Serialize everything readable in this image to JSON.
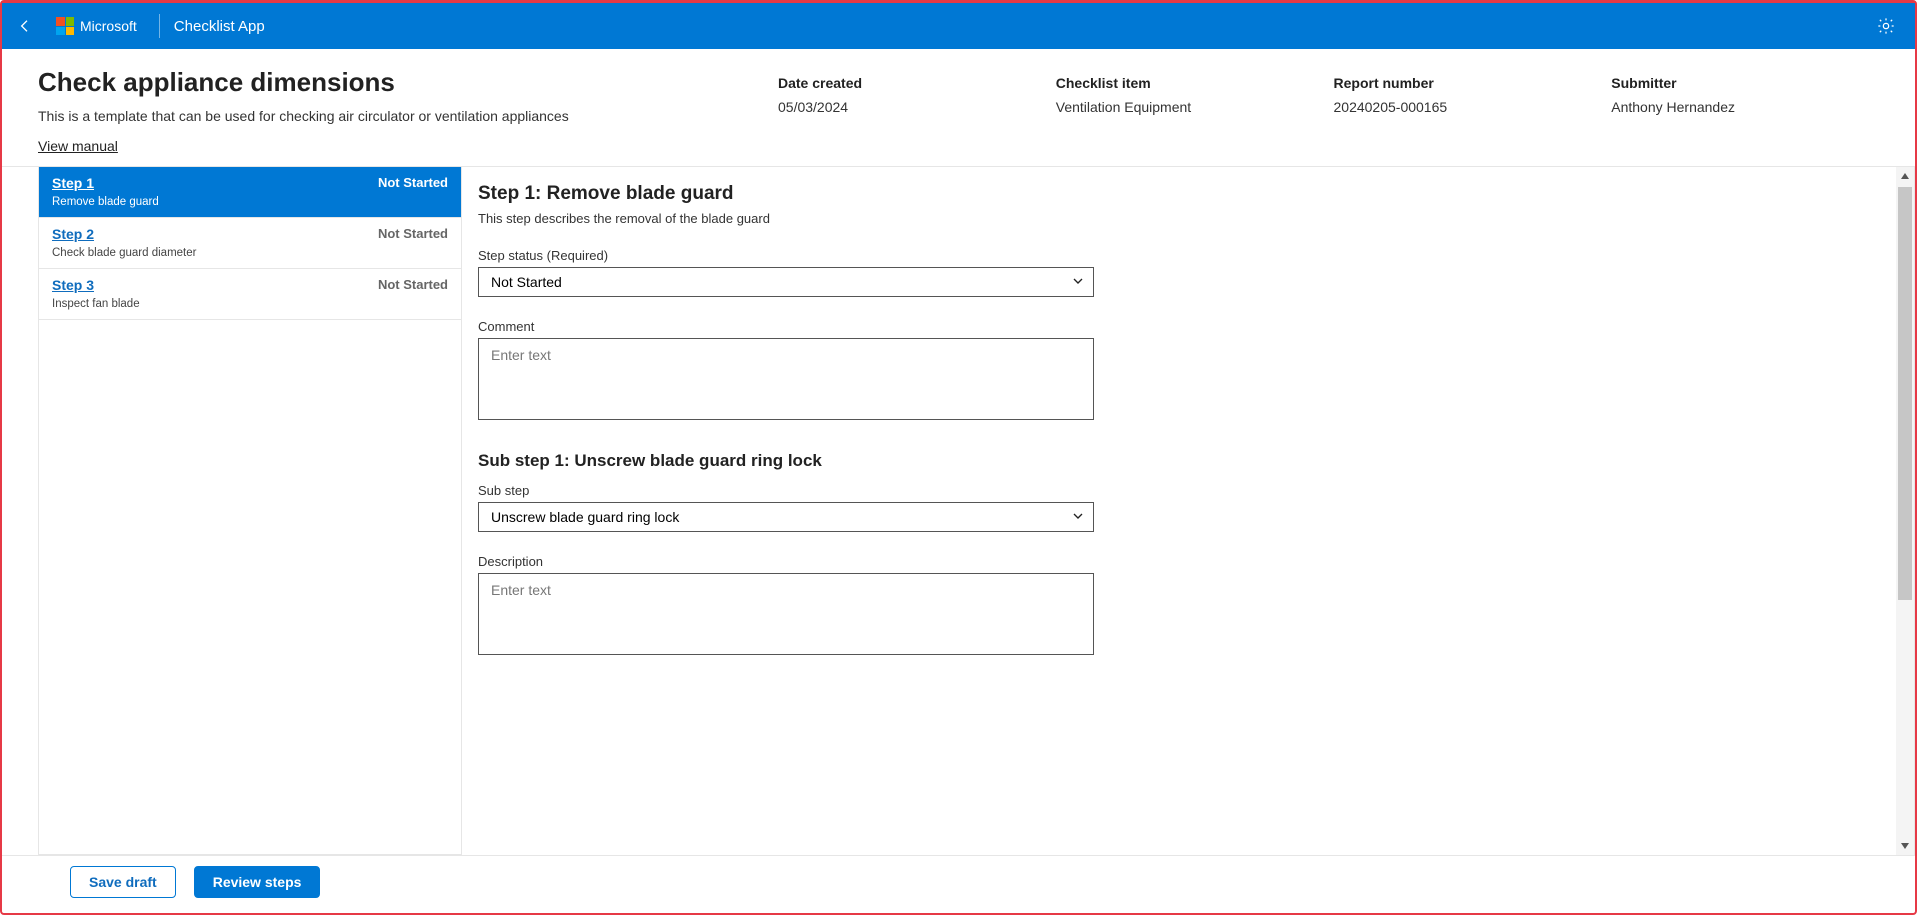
{
  "header": {
    "brand": "Microsoft",
    "app_name": "Checklist App"
  },
  "page": {
    "title": "Check appliance dimensions",
    "description": "This is a template that can be used for checking air circulator or ventilation appliances",
    "view_manual": "View manual"
  },
  "meta": {
    "date_created_label": "Date created",
    "date_created_value": "05/03/2024",
    "checklist_item_label": "Checklist item",
    "checklist_item_value": "Ventilation Equipment",
    "report_number_label": "Report number",
    "report_number_value": "20240205-000165",
    "submitter_label": "Submitter",
    "submitter_value": "Anthony Hernandez"
  },
  "steps": [
    {
      "label": "Step 1",
      "subtitle": "Remove blade guard",
      "status": "Not Started",
      "active": true
    },
    {
      "label": "Step 2",
      "subtitle": "Check blade guard diameter",
      "status": "Not Started",
      "active": false
    },
    {
      "label": "Step 3",
      "subtitle": "Inspect fan blade",
      "status": "Not Started",
      "active": false
    }
  ],
  "detail": {
    "title": "Step 1: Remove blade guard",
    "desc": "This step describes the removal of the blade guard",
    "status_label": "Step status (Required)",
    "status_value": "Not Started",
    "comment_label": "Comment",
    "comment_placeholder": "Enter text",
    "substep_title": "Sub step 1: Unscrew blade guard ring lock",
    "substep_label": "Sub step",
    "substep_value": "Unscrew blade guard ring lock",
    "description_label": "Description",
    "description_placeholder": "Enter text"
  },
  "footer": {
    "save_draft": "Save draft",
    "review_steps": "Review steps"
  }
}
